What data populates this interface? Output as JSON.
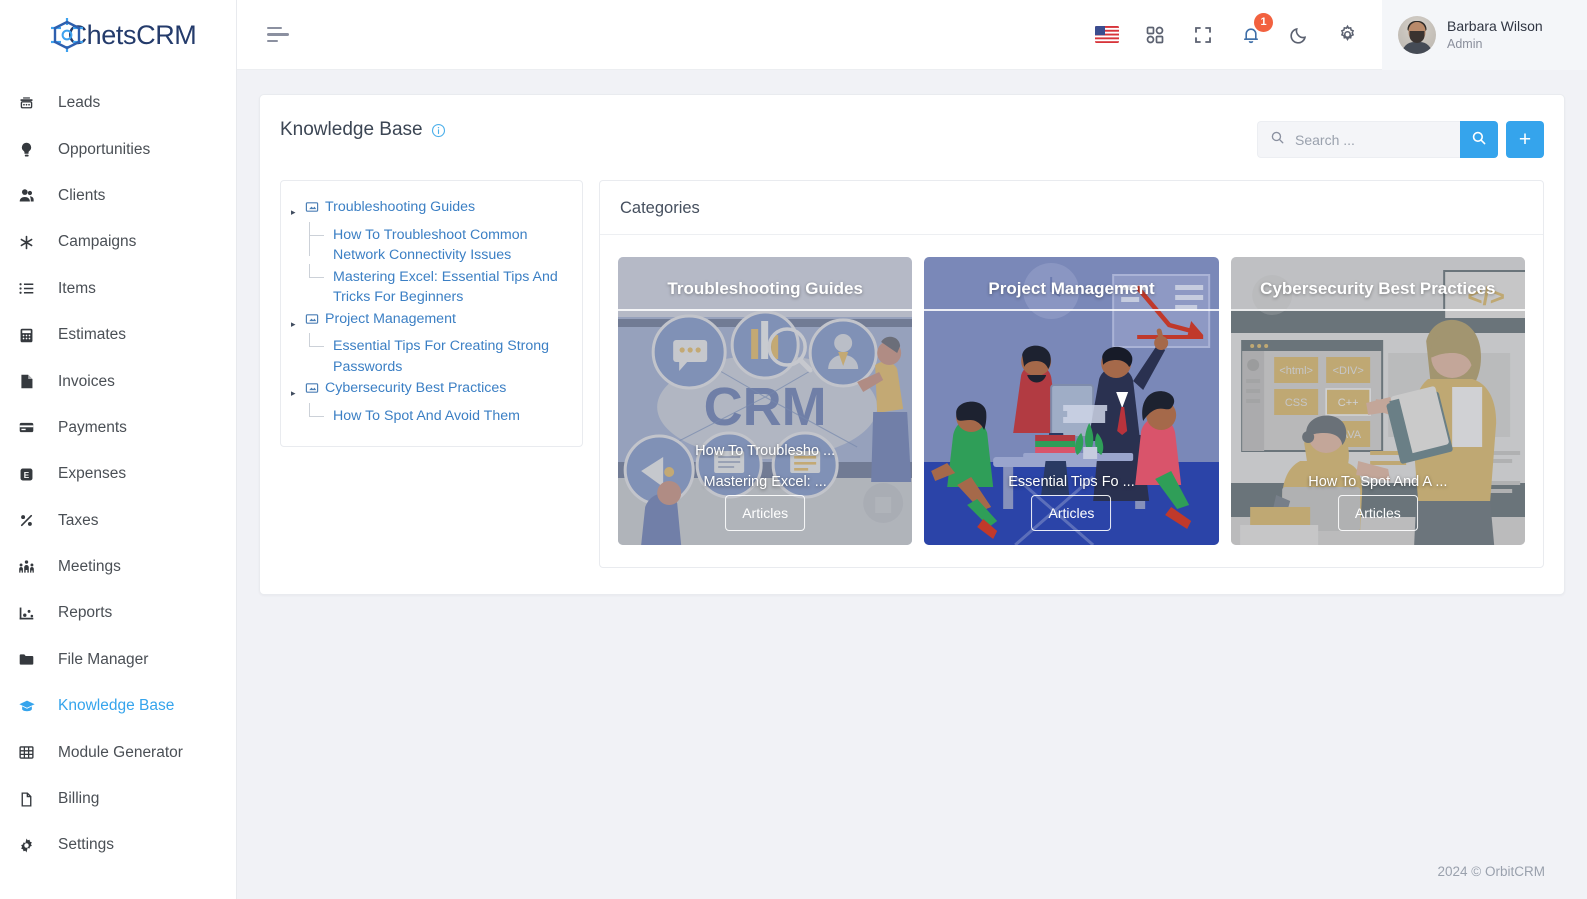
{
  "brand": {
    "name": "ChetsCRM"
  },
  "sidebar": {
    "items": [
      {
        "label": "Leads",
        "icon": "telephone-icon",
        "active": false
      },
      {
        "label": "Opportunities",
        "icon": "lightbulb-icon",
        "active": false
      },
      {
        "label": "Clients",
        "icon": "users-icon",
        "active": false
      },
      {
        "label": "Campaigns",
        "icon": "asterisk-icon",
        "active": false
      },
      {
        "label": "Items",
        "icon": "list-icon",
        "active": false
      },
      {
        "label": "Estimates",
        "icon": "calculator-icon",
        "active": false
      },
      {
        "label": "Invoices",
        "icon": "file-icon",
        "active": false
      },
      {
        "label": "Payments",
        "icon": "credit-card-icon",
        "active": false
      },
      {
        "label": "Expenses",
        "icon": "expense-icon",
        "active": false
      },
      {
        "label": "Taxes",
        "icon": "percent-icon",
        "active": false
      },
      {
        "label": "Meetings",
        "icon": "people-group-icon",
        "active": false
      },
      {
        "label": "Reports",
        "icon": "chart-icon",
        "active": false
      },
      {
        "label": "File Manager",
        "icon": "folder-icon",
        "active": false
      },
      {
        "label": "Knowledge Base",
        "icon": "graduation-cap-icon",
        "active": true
      },
      {
        "label": "Module Generator",
        "icon": "grid-table-icon",
        "active": false
      },
      {
        "label": "Billing",
        "icon": "document-icon",
        "active": false
      },
      {
        "label": "Settings",
        "icon": "gear-icon",
        "active": false
      }
    ]
  },
  "topbar": {
    "menu_toggle": "menu-toggle",
    "icons": [
      {
        "name": "language-flag-us",
        "label": "US"
      },
      {
        "name": "apps-grid-icon",
        "label": "Apps"
      },
      {
        "name": "fullscreen-icon",
        "label": "Fullscreen"
      },
      {
        "name": "notifications-bell-icon",
        "label": "Notifications",
        "badge": "1"
      },
      {
        "name": "dark-mode-moon-icon",
        "label": "Dark mode"
      },
      {
        "name": "settings-gear-icon",
        "label": "Settings"
      }
    ],
    "notification_count": "1",
    "user": {
      "name": "Barbara Wilson",
      "role": "Admin"
    }
  },
  "page": {
    "title": "Knowledge Base",
    "info_tooltip_icon": "info-circle-icon"
  },
  "search": {
    "placeholder": "Search ...",
    "value": "",
    "button_icon": "search-icon",
    "add_label": "+"
  },
  "tree": {
    "nodes": [
      {
        "label": "Troubleshooting Guides",
        "children": [
          "How To Troubleshoot Common Network Connectivity Issues",
          "Mastering Excel: Essential Tips And Tricks For Beginners"
        ]
      },
      {
        "label": "Project Management",
        "children": [
          "Essential Tips For Creating Strong Passwords"
        ]
      },
      {
        "label": "Cybersecurity Best Practices",
        "children": [
          "How To Spot And Avoid Them"
        ]
      }
    ]
  },
  "categories": {
    "heading": "Categories",
    "cards": [
      {
        "title": "Troubleshooting Guides",
        "articles": [
          "How To Troublesho ...",
          "Mastering Excel: ..."
        ],
        "button_label": "Articles",
        "dimmed": true
      },
      {
        "title": "Project Management",
        "articles": [
          "Essential Tips Fo ..."
        ],
        "button_label": "Articles",
        "dimmed": false
      },
      {
        "title": "Cybersecurity Best Practices",
        "articles": [
          "How To Spot And A ..."
        ],
        "button_label": "Articles",
        "dimmed": true
      }
    ]
  },
  "footer": {
    "copyright": "2024 © OrbitCRM"
  },
  "colors": {
    "accent": "#35a4ec",
    "link": "#3b7fc4",
    "badge": "#f2613f",
    "page_bg": "#f1f2f6",
    "sidebar_bg": "#ffffff",
    "brand_text": "#243b6b"
  }
}
